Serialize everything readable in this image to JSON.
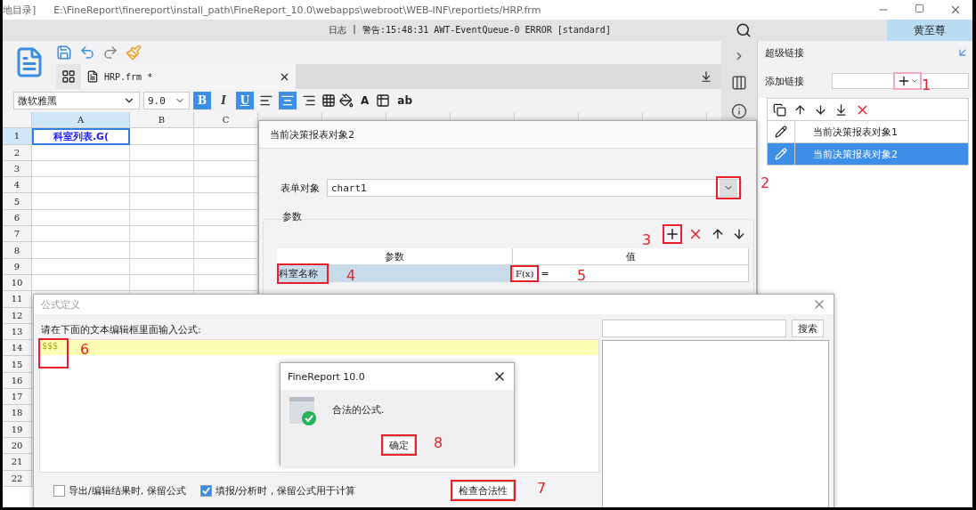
{
  "title_bar": {
    "location": "地目录]",
    "path": "E:\\FineReport\\finereport\\install_path\\FineReport_10.0\\webapps\\webroot\\WEB-INF\\reportlets/HRP.frm"
  },
  "log_bar": {
    "label": "日志",
    "separator": "|",
    "message": "警告:15:48:31 AWT-EventQueue-0 ERROR [standard]",
    "user": "黄至尊"
  },
  "tab": {
    "label": "HRP.frm *"
  },
  "format_bar": {
    "font": "微软雅黑",
    "size": "9.0",
    "styles": [
      {
        "label": "B",
        "selected": true
      },
      {
        "label": "I",
        "selected": false
      },
      {
        "label": "U",
        "selected": true
      }
    ],
    "align": [
      {
        "selected": false
      },
      {
        "selected": true
      },
      {
        "selected": false
      }
    ],
    "font_color": "A",
    "text_tool": "ab"
  },
  "sheet": {
    "columns": [
      "A",
      "B",
      "C"
    ],
    "rows": [
      {
        "label": "1",
        "value": "科室列表.G(",
        "selected": true
      },
      {
        "label": "2",
        "selected": false
      },
      {
        "label": "3",
        "selected": false
      },
      {
        "label": "4",
        "selected": false
      },
      {
        "label": "5",
        "selected": false
      },
      {
        "label": "6",
        "selected": false
      },
      {
        "label": "7",
        "selected": false
      },
      {
        "label": "8",
        "selected": false
      },
      {
        "label": "9",
        "selected": false
      },
      {
        "label": "10",
        "selected": false
      },
      {
        "label": "11",
        "selected": false
      },
      {
        "label": "12",
        "selected": false
      },
      {
        "label": "13",
        "selected": false
      },
      {
        "label": "14",
        "selected": false
      },
      {
        "label": "15",
        "selected": false
      },
      {
        "label": "16",
        "selected": false
      },
      {
        "label": "17",
        "selected": false
      },
      {
        "label": "18",
        "selected": false
      },
      {
        "label": "19",
        "selected": false
      },
      {
        "label": "20",
        "selected": false
      },
      {
        "label": "21",
        "selected": false
      },
      {
        "label": "22",
        "selected": false
      }
    ]
  },
  "side_panel": {
    "title": "超级链接",
    "add_label": "添加链接",
    "marker": "1",
    "items": [
      {
        "label": "当前决策报表对象1",
        "selected": false
      },
      {
        "label": "当前决策报表对象2",
        "selected": true
      }
    ]
  },
  "link_editor": {
    "title": "当前决策报表对象2",
    "object_label": "表单对象",
    "object_value": "chart1",
    "object_marker": "2",
    "params_legend": "参数",
    "toolbar_marker": "3",
    "columns": [
      "参数",
      "值"
    ],
    "params": [
      {
        "name": "科室名称",
        "name_marker": "4",
        "formula_button": "F(x)",
        "value": "=",
        "value_marker": "5"
      }
    ]
  },
  "formula_dialog": {
    "title": "公式定义",
    "prompt": "请在下面的文本编辑框里面输入公式:",
    "formula": "$$$",
    "formula_marker": "6",
    "search_button": "搜索",
    "options": [
      {
        "label": "导出/编辑结果时, 保留公式",
        "checked": false
      },
      {
        "label": "填报/分析时，保留公式用于计算",
        "checked": true
      }
    ],
    "check_button": "检查合法性",
    "check_marker": "7"
  },
  "message_box": {
    "title": "FineReport 10.0",
    "message": "合法的公式.",
    "ok_button": "确定",
    "ok_marker": "8"
  }
}
